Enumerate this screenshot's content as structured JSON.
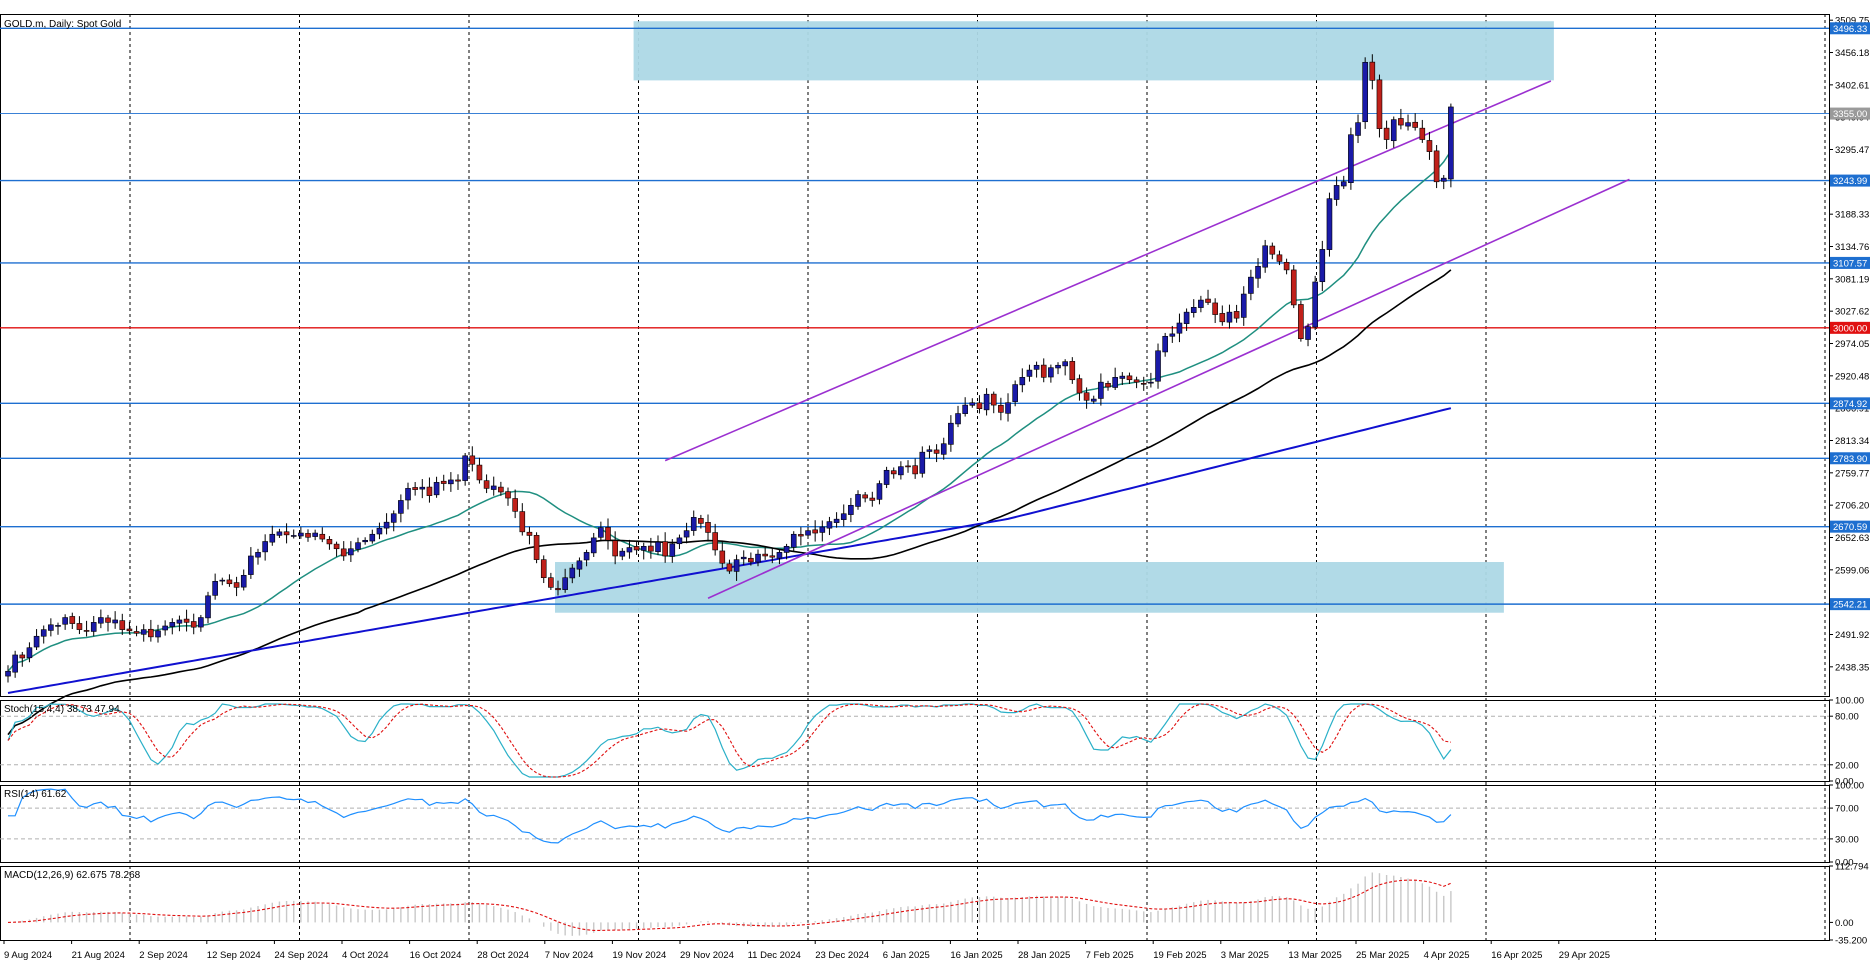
{
  "header": {
    "symbol_label": "GOLD.m, Daily:  Spot Gold"
  },
  "colors": {
    "bull": "#1a1aa8",
    "bear": "#c0201a",
    "sma_short": "#1f8f80",
    "sma_mid": "#000000",
    "sma_long": "#1010d0",
    "level_line": "#1e6fd0",
    "key_level": "#e01010",
    "channel": "#9b30d0",
    "zone_fill": "#add8e6",
    "stoch_main": "#2ab0c8",
    "stoch_signal": "#e01010",
    "rsi": "#1e8fff",
    "macd_hist": "#c8c8c8",
    "macd_signal": "#e01010"
  },
  "chart_data": [
    {
      "type": "candlestick",
      "name": "Price",
      "ylim": [
        2390,
        3520
      ],
      "y_ticks": [
        "3509.75",
        "3456.18",
        "3402.61",
        "3349.04",
        "3295.47",
        "3241.90",
        "3188.33",
        "3134.76",
        "3081.19",
        "3027.62",
        "2974.05",
        "2920.48",
        "2866.91",
        "2813.34",
        "2759.77",
        "2706.20",
        "2652.63",
        "2599.06",
        "2545.49",
        "2491.92",
        "2438.35"
      ],
      "x_tick_labels": [
        "9 Aug 2024",
        "21 Aug 2024",
        "2 Sep 2024",
        "12 Sep 2024",
        "24 Sep 2024",
        "4 Oct 2024",
        "16 Oct 2024",
        "28 Oct 2024",
        "7 Nov 2024",
        "19 Nov 2024",
        "29 Nov 2024",
        "11 Dec 2024",
        "23 Dec 2024",
        "6 Jan 2025",
        "16 Jan 2025",
        "28 Jan 2025",
        "7 Feb 2025",
        "19 Feb 2025",
        "3 Mar 2025",
        "13 Mar 2025",
        "25 Mar 2025",
        "4 Apr 2025",
        "16 Apr 2025",
        "29 Apr 2025"
      ],
      "close": [
        2431,
        2458,
        2453,
        2470,
        2489,
        2500,
        2508,
        2507,
        2520,
        2510,
        2500,
        2498,
        2512,
        2520,
        2512,
        2516,
        2500,
        2498,
        2494,
        2500,
        2488,
        2498,
        2506,
        2512,
        2516,
        2512,
        2504,
        2520,
        2556,
        2580,
        2582,
        2576,
        2570,
        2590,
        2622,
        2628,
        2646,
        2658,
        2662,
        2657,
        2656,
        2660,
        2653,
        2660,
        2650,
        2642,
        2634,
        2622,
        2634,
        2644,
        2648,
        2658,
        2668,
        2678,
        2692,
        2714,
        2734,
        2732,
        2736,
        2722,
        2744,
        2742,
        2748,
        2746,
        2788,
        2774,
        2748,
        2734,
        2738,
        2728,
        2718,
        2696,
        2662,
        2656,
        2616,
        2586,
        2570,
        2566,
        2586,
        2602,
        2614,
        2628,
        2652,
        2669,
        2648,
        2622,
        2630,
        2636,
        2632,
        2638,
        2630,
        2645,
        2622,
        2642,
        2652,
        2664,
        2686,
        2676,
        2661,
        2632,
        2610,
        2597,
        2616,
        2620,
        2612,
        2625,
        2622,
        2620,
        2628,
        2638,
        2658,
        2655,
        2664,
        2660,
        2670,
        2679,
        2683,
        2692,
        2706,
        2724,
        2718,
        2714,
        2742,
        2764,
        2758,
        2770,
        2770,
        2758,
        2794,
        2798,
        2792,
        2808,
        2842,
        2858,
        2872,
        2876,
        2866,
        2890,
        2872,
        2860,
        2876,
        2906,
        2918,
        2930,
        2938,
        2918,
        2934,
        2938,
        2944,
        2914,
        2892,
        2880,
        2882,
        2910,
        2902,
        2918,
        2920,
        2914,
        2910,
        2908,
        2910,
        2962,
        2986,
        2990,
        3008,
        3026,
        3034,
        3046,
        3042,
        3022,
        3010,
        3026,
        3016,
        3056,
        3084,
        3102,
        3136,
        3122,
        3110,
        3096,
        3038,
        2982,
        3002,
        3076,
        3130,
        3214,
        3236,
        3242,
        3320,
        3340,
        3440,
        3410,
        3330,
        3312,
        3345,
        3336,
        3340,
        3332,
        3312,
        3292,
        3242,
        3248,
        3366
      ],
      "sma_short_period": 20,
      "sma_mid_period": 50,
      "sma_long_period": 200,
      "horizontal_levels": [
        "3496.33",
        "3355.00",
        "3243.99",
        "3107.57",
        "3000.00",
        "2874.92",
        "2783.90",
        "2670.59",
        "2542.21"
      ],
      "zones": [
        {
          "x_from_bar": 88,
          "x_to_bar": 216,
          "y_from": 3410,
          "y_to": 3508
        },
        {
          "x_from_bar": 77,
          "x_to_bar": 209,
          "y_from": 2528,
          "y_to": 2612
        }
      ],
      "channel_upper": [
        [
          92,
          2780
        ],
        [
          216,
          3409
        ]
      ],
      "channel_lower": [
        [
          98,
          2552
        ],
        [
          227,
          3246
        ]
      ]
    },
    {
      "type": "line",
      "name": "Stoch(15,4,4)",
      "label": "Stoch(15,4,4) 38.73 47.94",
      "ylim": [
        0,
        100
      ],
      "y_ticks": [
        "100.00",
        "80.00",
        "20.00",
        "0.00"
      ],
      "levels": [
        80,
        20
      ],
      "last_values": [
        38.73,
        47.94
      ]
    },
    {
      "type": "line",
      "name": "RSI(14)",
      "label": "RSI(14) 61.62",
      "ylim": [
        0,
        100
      ],
      "y_ticks": [
        "100.00",
        "70.00",
        "30.00",
        "0.00"
      ],
      "levels": [
        70,
        30
      ],
      "last_value": 61.62
    },
    {
      "type": "bar",
      "name": "MACD(12,26,9)",
      "label": "MACD(12,26,9) 62.675 78.268",
      "ylim": [
        -35.2,
        112.794
      ],
      "y_ticks": [
        "112.794",
        "0.00",
        "-35.200"
      ],
      "last_values": [
        62.675,
        78.268
      ]
    }
  ]
}
